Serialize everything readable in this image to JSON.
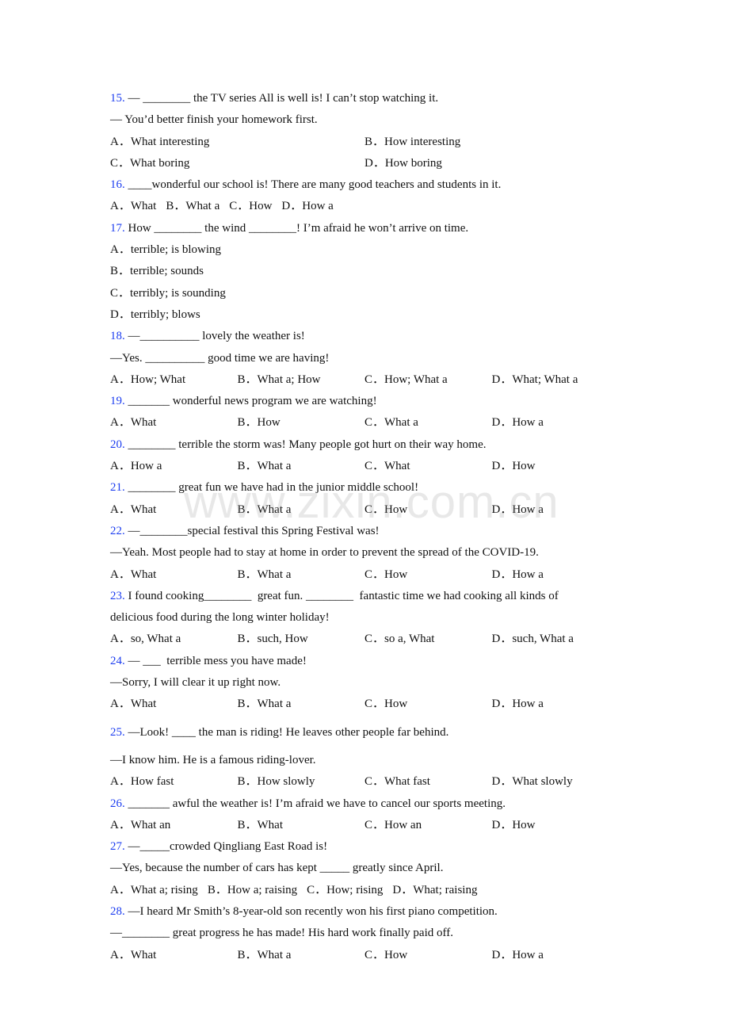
{
  "watermark": "www.zixin.com.cn",
  "questions": [
    {
      "num": "15.",
      "lines": [
        " — ________ the TV series All is well is! I can’t stop watching it.",
        "— You’d better finish your homework first."
      ],
      "layout": "two",
      "options": [
        "A．What interesting",
        "B．How interesting",
        "C．What boring",
        "D．How boring"
      ]
    },
    {
      "num": "16.",
      "lines": [
        " ____wonderful our school is! There are many good teachers and students in it."
      ],
      "layout": "inline",
      "options": [
        "A．What",
        "B．What a",
        "C．How",
        "D．How a"
      ]
    },
    {
      "num": "17.",
      "lines": [
        " How ________ the wind ________! I’m afraid he won’t arrive on time."
      ],
      "layout": "stack",
      "options": [
        "A．terrible; is blowing",
        "B．terrible; sounds",
        "C．terribly; is sounding",
        "D．terribly; blows"
      ]
    },
    {
      "num": "18.",
      "lines": [
        " —__________ lovely the weather is!",
        "—Yes. __________ good time we are having!"
      ],
      "layout": "four",
      "options": [
        "A．How; What",
        "B．What a; How",
        "C．How; What a",
        "D．What; What a"
      ]
    },
    {
      "num": "19.",
      "lines": [
        " _______ wonderful news program we are watching!"
      ],
      "layout": "four",
      "options": [
        "A．What",
        "B．How",
        "C．What a",
        "D．How a"
      ]
    },
    {
      "num": "20.",
      "lines": [
        " ________ terrible the storm was! Many people got hurt on their way home."
      ],
      "layout": "four",
      "options": [
        "A．How a",
        "B．What a",
        "C．What",
        "D．How"
      ]
    },
    {
      "num": "21.",
      "lines": [
        " ________ great fun we have had in the junior middle school!"
      ],
      "layout": "four",
      "options": [
        "A．What",
        "B．What a",
        "C．How",
        "D．How a"
      ]
    },
    {
      "num": "22.",
      "lines": [
        " —________special festival this Spring Festival was!",
        "—Yeah. Most people had to stay at home in order to prevent the spread of the COVID-19."
      ],
      "layout": "four",
      "options": [
        "A．What",
        "B．What a",
        "C．How",
        "D．How a"
      ]
    },
    {
      "num": "23.",
      "lines": [
        " I found cooking________  great fun. ________  fantastic time we had cooking all kinds of",
        "delicious food during the long winter holiday!"
      ],
      "layout": "four",
      "options": [
        "A．so, What a",
        "B．such, How",
        "C．so a, What",
        "D．such, What a"
      ]
    },
    {
      "num": "24.",
      "lines": [
        " — ___  terrible mess you have made!",
        "—Sorry, I will clear it up right now."
      ],
      "layout": "four",
      "options": [
        "A．What",
        "B．What a",
        "C．How",
        "D．How a"
      ],
      "gap_after": true
    },
    {
      "num": "25.",
      "lines": [
        " —Look! ____ the man is riding! He leaves other people far behind.",
        "GAP",
        "—I know him. He is a famous riding-lover."
      ],
      "layout": "four",
      "options": [
        "A．How fast",
        "B．How slowly",
        "C．What fast",
        "D．What slowly"
      ]
    },
    {
      "num": "26.",
      "lines": [
        " _______ awful the weather is! I’m afraid we have to cancel our sports meeting."
      ],
      "layout": "four",
      "options": [
        "A．What an",
        "B．What",
        "C．How an",
        "D．How"
      ]
    },
    {
      "num": "27.",
      "lines": [
        " —_____crowded Qingliang East Road is!",
        "—Yes, because the number of cars has kept _____ greatly since April."
      ],
      "layout": "inline",
      "options": [
        "A．What a; rising",
        "B．How a; raising",
        "C．How; rising",
        "D．What; raising"
      ]
    },
    {
      "num": "28.",
      "lines": [
        " —I heard Mr Smith’s 8-year-old son recently won his first piano competition.",
        "—________ great progress he has made! His hard work finally paid off."
      ],
      "layout": "four",
      "options": [
        "A．What",
        "B．What a",
        "C．How",
        "D．How a"
      ]
    }
  ]
}
